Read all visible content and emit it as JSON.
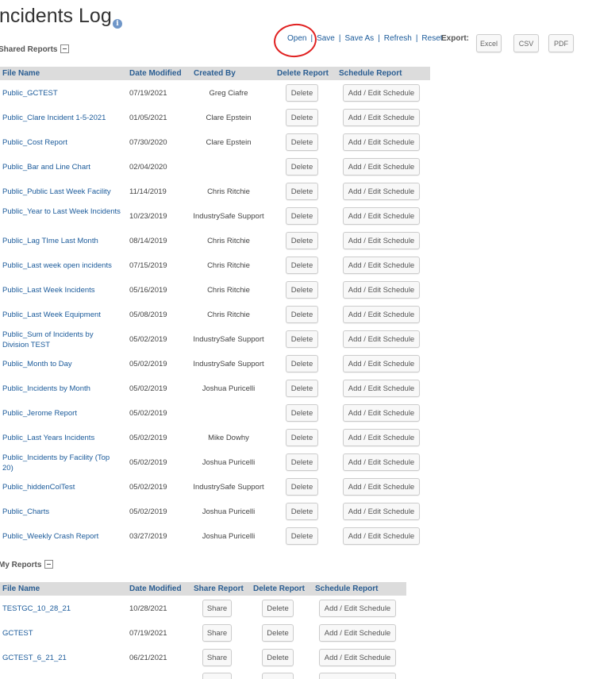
{
  "page": {
    "title": "Incidents Log",
    "info_icon": "info-icon",
    "annotation_color": "#e02020"
  },
  "toolbar": {
    "open": "Open",
    "save": "Save",
    "save_as": "Save As",
    "refresh": "Refresh",
    "reset": "Reset",
    "separator": "|"
  },
  "export": {
    "label": "Export:",
    "excel": "Excel",
    "csv": "CSV",
    "pdf": "PDF"
  },
  "shared_reports": {
    "title": "Shared Reports",
    "headers": {
      "file_name": "File Name",
      "date_modified": "Date Modified",
      "created_by": "Created By",
      "delete_report": "Delete Report",
      "schedule_report": "Schedule Report"
    },
    "delete_label": "Delete",
    "schedule_label": "Add / Edit Schedule",
    "rows": [
      {
        "file": "Public_GCTEST",
        "date": "07/19/2021",
        "created_by": "Greg Ciafre"
      },
      {
        "file": "Public_Clare Incident 1-5-2021",
        "date": "01/05/2021",
        "created_by": "Clare Epstein"
      },
      {
        "file": "Public_Cost Report",
        "date": "07/30/2020",
        "created_by": "Clare Epstein"
      },
      {
        "file": "Public_Bar and Line Chart",
        "date": "02/04/2020",
        "created_by": ""
      },
      {
        "file": "Public_Public Last Week Facility",
        "date": "11/14/2019",
        "created_by": "Chris Ritchie"
      },
      {
        "file": "Public_Year to Last Week Incidents",
        "date": "10/23/2019",
        "created_by": "IndustrySafe Support"
      },
      {
        "file": "Public_Lag TIme Last Month",
        "date": "08/14/2019",
        "created_by": "Chris Ritchie"
      },
      {
        "file": "Public_Last week open incidents",
        "date": "07/15/2019",
        "created_by": "Chris Ritchie"
      },
      {
        "file": "Public_Last Week Incidents",
        "date": "05/16/2019",
        "created_by": "Chris Ritchie"
      },
      {
        "file": "Public_Last Week Equipment",
        "date": "05/08/2019",
        "created_by": "Chris Ritchie"
      },
      {
        "file": "Public_Sum of Incidents by Division TEST",
        "date": "05/02/2019",
        "created_by": "IndustrySafe Support"
      },
      {
        "file": "Public_Month to Day",
        "date": "05/02/2019",
        "created_by": "IndustrySafe Support"
      },
      {
        "file": "Public_Incidents by Month",
        "date": "05/02/2019",
        "created_by": "Joshua Puricelli"
      },
      {
        "file": "Public_Jerome Report",
        "date": "05/02/2019",
        "created_by": ""
      },
      {
        "file": "Public_Last Years Incidents",
        "date": "05/02/2019",
        "created_by": "Mike Dowhy"
      },
      {
        "file": "Public_Incidents by Facility (Top 20)",
        "date": "05/02/2019",
        "created_by": "Joshua Puricelli"
      },
      {
        "file": "Public_hiddenColTest",
        "date": "05/02/2019",
        "created_by": "IndustrySafe Support"
      },
      {
        "file": "Public_Charts",
        "date": "05/02/2019",
        "created_by": "Joshua Puricelli"
      },
      {
        "file": "Public_Weekly Crash Report",
        "date": "03/27/2019",
        "created_by": "Joshua Puricelli"
      }
    ]
  },
  "my_reports": {
    "title": "My Reports",
    "headers": {
      "file_name": "File Name",
      "date_modified": "Date Modified",
      "share_report": "Share Report",
      "delete_report": "Delete Report",
      "schedule_report": "Schedule Report"
    },
    "share_label": "Share",
    "delete_label": "Delete",
    "schedule_label": "Add / Edit Schedule",
    "rows": [
      {
        "file": "TESTGC_10_28_21",
        "date": "10/28/2021"
      },
      {
        "file": "GCTEST",
        "date": "07/19/2021"
      },
      {
        "file": "GCTEST_6_21_21",
        "date": "06/21/2021"
      }
    ]
  }
}
